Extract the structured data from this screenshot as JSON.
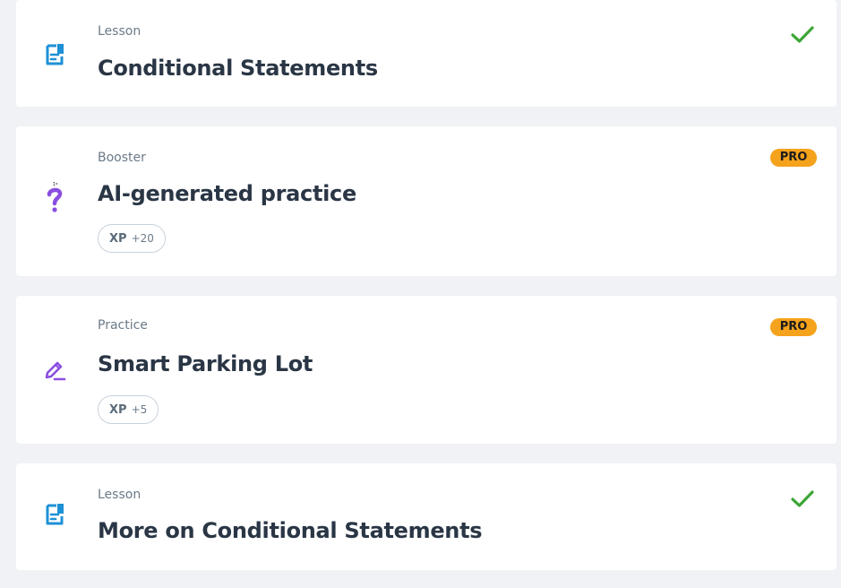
{
  "items": [
    {
      "type": "Lesson",
      "title": "Conditional Statements",
      "icon": "lesson-document-icon",
      "status": "completed"
    },
    {
      "type": "Booster",
      "title": "AI-generated practice",
      "icon": "question-mark-icon",
      "badge": "PRO",
      "xp_label": "XP",
      "xp_value": "+20"
    },
    {
      "type": "Practice",
      "title": "Smart Parking Lot",
      "icon": "pencil-icon",
      "badge": "PRO",
      "xp_label": "XP",
      "xp_value": "+5"
    },
    {
      "type": "Lesson",
      "title": "More on Conditional Statements",
      "icon": "lesson-document-icon",
      "status": "completed"
    }
  ],
  "colors": {
    "background": "#f0f2f5",
    "card": "#ffffff",
    "lesson_icon": "#1e90d6",
    "purple_icon": "#8a4ee0",
    "check": "#3ca636",
    "pro_badge": "#f5a21c"
  }
}
